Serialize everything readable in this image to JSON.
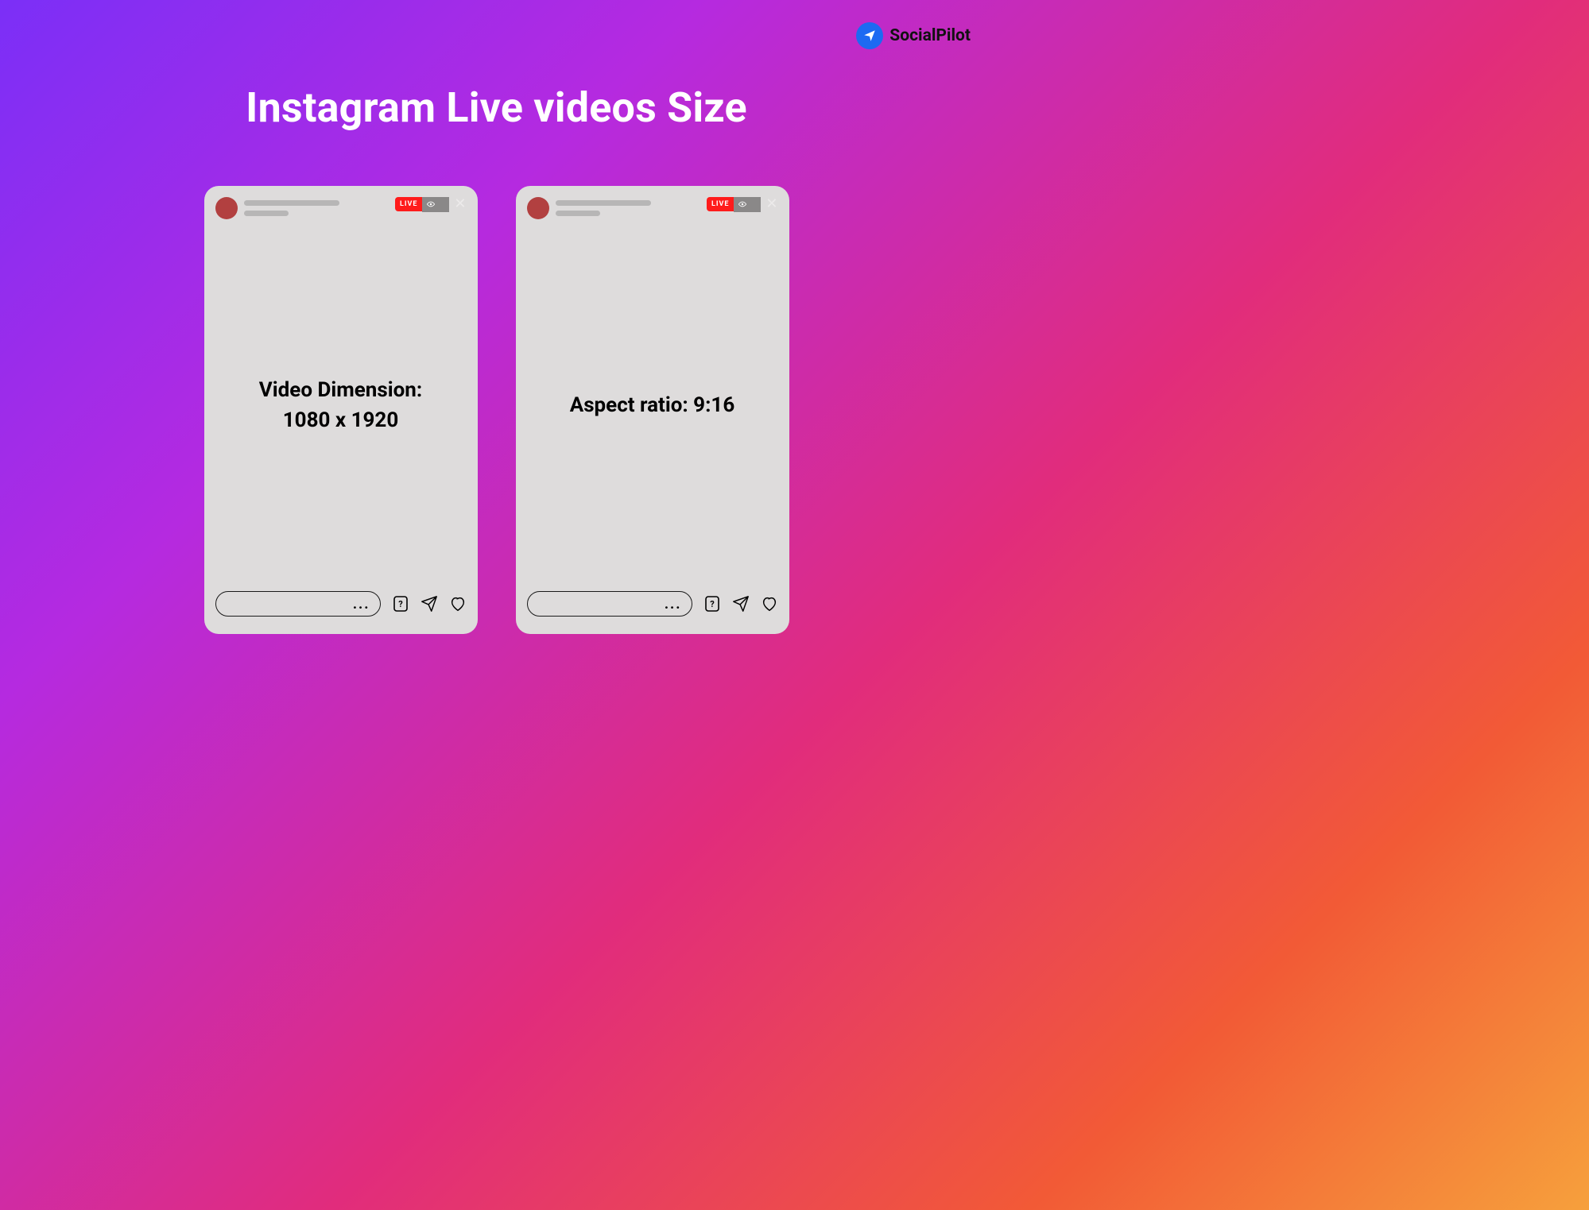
{
  "brand": {
    "name": "SocialPilot"
  },
  "title": "Instagram Live videos Size",
  "live_label": "LIVE",
  "comment_ellipsis": "...",
  "cards": [
    {
      "lines": [
        "Video Dimension:",
        "1080 x 1920"
      ]
    },
    {
      "lines": [
        "Aspect ratio: 9:16"
      ]
    }
  ]
}
